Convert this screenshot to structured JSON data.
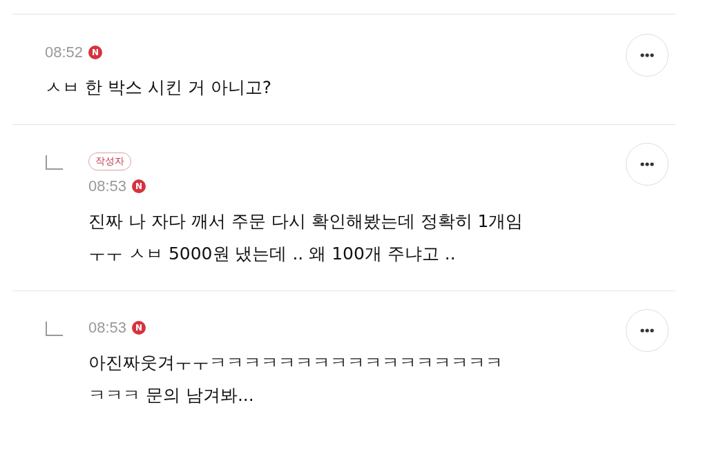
{
  "comments": [
    {
      "kind": "comment",
      "time": "08:52",
      "new_badge": "N",
      "lines": [
        "ㅅㅂ 한 박스 시킨 거 아니고?"
      ]
    },
    {
      "kind": "reply",
      "author_badge": "작성자",
      "time": "08:53",
      "new_badge": "N",
      "lines": [
        "진짜 나 자다 깨서 주문 다시 확인해봤는데 정확히 1개임",
        "ㅜㅜ ㅅㅂ 5000원 냈는데 .. 왜 100개 주냐고 .."
      ]
    },
    {
      "kind": "reply",
      "time": "08:53",
      "new_badge": "N",
      "lines": [
        "아진짜웃겨ㅜㅜㅋㅋㅋㅋㅋㅋㅋㅋㅋㅋㅋㅋㅋㅋㅋㅋㅋ",
        "ㅋㅋㅋ 문의 남겨봐..."
      ]
    }
  ]
}
